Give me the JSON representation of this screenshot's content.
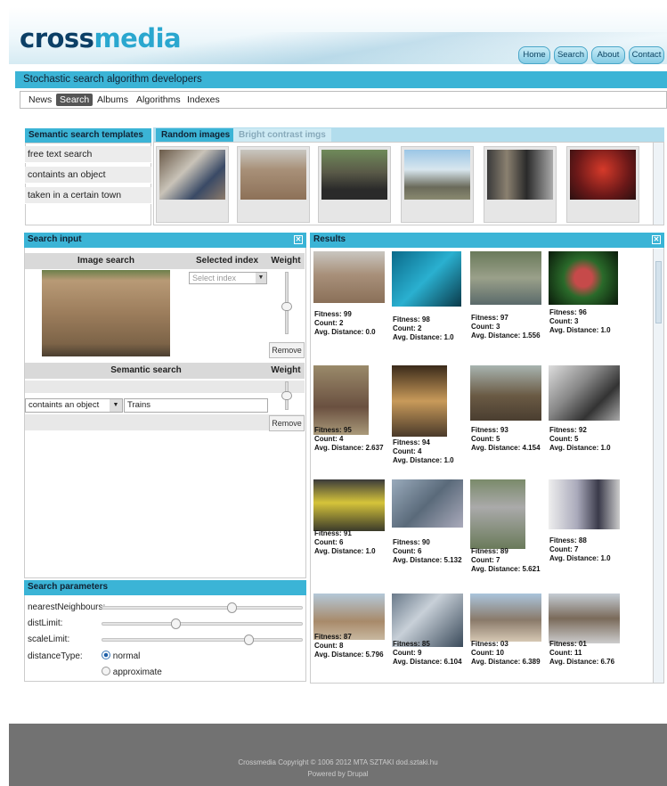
{
  "header": {
    "logo_part1": "cross",
    "logo_part2": "media",
    "nav": [
      "Home",
      "Search",
      "About",
      "Contact"
    ]
  },
  "tagline": "Stochastic search algorithm developers",
  "menu": {
    "items": [
      "News",
      "Search",
      "Albums",
      "Algorithms",
      "Indexes"
    ],
    "active": "Search"
  },
  "templates": {
    "title": "Semantic search templates",
    "items": [
      "free text search",
      "containts an object",
      "taken in a certain town"
    ]
  },
  "tabs": {
    "active": "Random images",
    "inactive": "Bright contrast imgs"
  },
  "search_input": {
    "title": "Search input",
    "image_search_label": "Image search",
    "selected_index_label": "Selected index",
    "select_placeholder": "Select index",
    "weight_label": "Weight",
    "remove_label": "Remove",
    "semantic_search_label": "Semantic search",
    "semantic_dropdown": "containts an object",
    "semantic_value": "Trains"
  },
  "search_params": {
    "title": "Search parameters",
    "params": [
      {
        "label": "nearestNeighbours:",
        "value": 0.65
      },
      {
        "label": "distLimit:",
        "value": 0.36
      },
      {
        "label": "scaleLimit:",
        "value": 0.74
      }
    ],
    "distance_type_label": "distanceType:",
    "options": [
      "normal",
      "approximate"
    ],
    "selected_option": "normal"
  },
  "results": {
    "title": "Results",
    "fitness_label": "Fitness:",
    "count_label": "Count:",
    "avg_label": "Avg. Distance:",
    "items": [
      {
        "fitness": "99",
        "count": "2",
        "avg": "0.0"
      },
      {
        "fitness": "98",
        "count": "2",
        "avg": "1.0"
      },
      {
        "fitness": "97",
        "count": "3",
        "avg": "1.556"
      },
      {
        "fitness": "96",
        "count": "3",
        "avg": "1.0"
      },
      {
        "fitness": "95",
        "count": "4",
        "avg": "2.637"
      },
      {
        "fitness": "94",
        "count": "4",
        "avg": "1.0"
      },
      {
        "fitness": "93",
        "count": "5",
        "avg": "4.154"
      },
      {
        "fitness": "92",
        "count": "5",
        "avg": "1.0"
      },
      {
        "fitness": "91",
        "count": "6",
        "avg": "1.0"
      },
      {
        "fitness": "90",
        "count": "6",
        "avg": "5.132"
      },
      {
        "fitness": "89",
        "count": "7",
        "avg": "5.621"
      },
      {
        "fitness": "88",
        "count": "7",
        "avg": "1.0"
      },
      {
        "fitness": "87",
        "count": "8",
        "avg": "5.796"
      },
      {
        "fitness": "85",
        "count": "9",
        "avg": "6.104"
      },
      {
        "fitness": "03",
        "count": "10",
        "avg": "6.389"
      },
      {
        "fitness": "01",
        "count": "11",
        "avg": "6.76"
      }
    ]
  },
  "footer": {
    "line1": "Crossmedia Copyright © 1006 2012 MTA SZTAKI   dod.sztaki.hu",
    "line2": "Powered by Drupal"
  },
  "colors": {
    "accent": "#3bb4d6",
    "footer": "#727272"
  }
}
